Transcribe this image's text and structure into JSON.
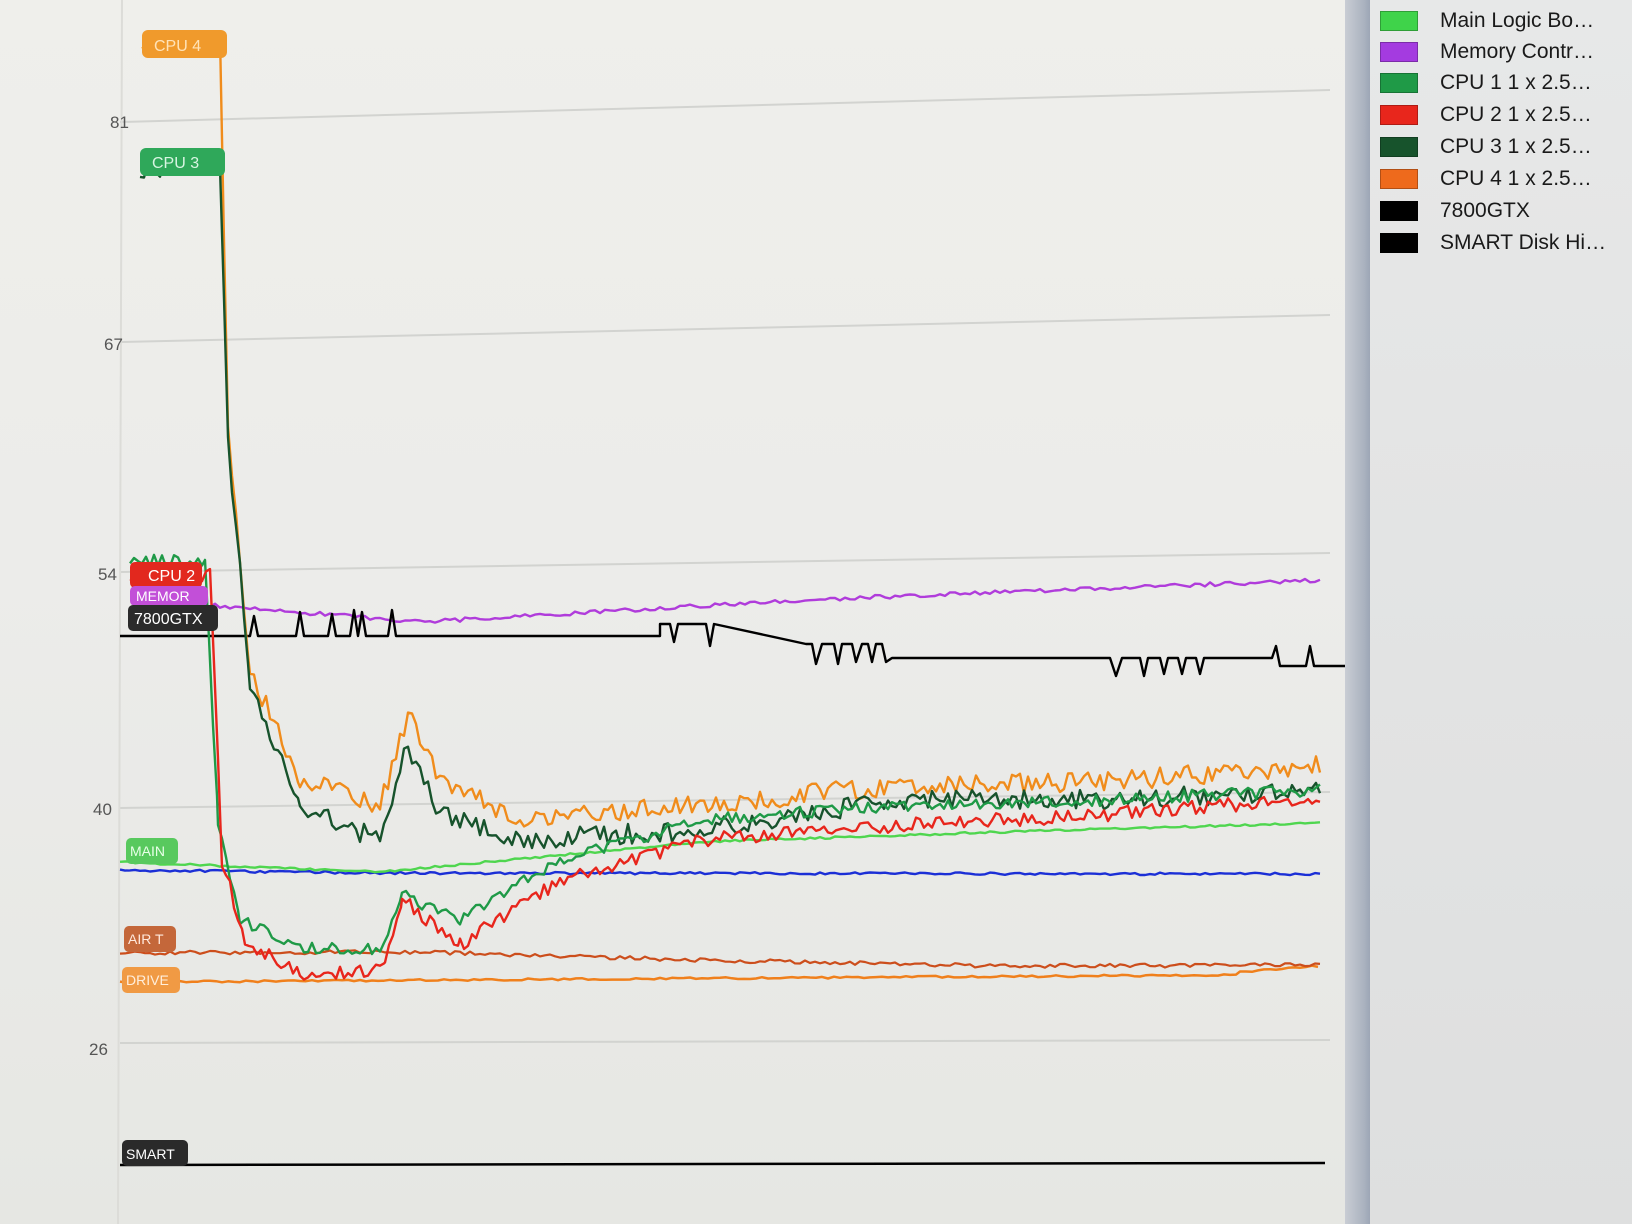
{
  "y_axis": {
    "ticks": [
      "81",
      "67",
      "54",
      "40",
      "26"
    ]
  },
  "tags": {
    "cpu4": "CPU 4",
    "cpu3": "CPU 3",
    "cpu2": "CPU 2",
    "memory": "MEMOR",
    "gpu": "7800GTX",
    "main": "MAIN",
    "air": "AIR T",
    "drive": "DRIVE",
    "smart": "SMART"
  },
  "legend": [
    {
      "label": "Main Logic Bo…",
      "color": "#3fd34a"
    },
    {
      "label": "Memory Contr…",
      "color": "#a43be0"
    },
    {
      "label": "CPU 1  1 x 2.5…",
      "color": "#1f9a47"
    },
    {
      "label": "CPU 2  1 x 2.5…",
      "color": "#e8261c"
    },
    {
      "label": "CPU 3  1 x 2.5…",
      "color": "#17532c"
    },
    {
      "label": "CPU 4  1 x 2.5…",
      "color": "#ee6a1c"
    },
    {
      "label": "7800GTX",
      "color": "#000000"
    },
    {
      "label": "SMART Disk Hi…",
      "color": "#000000"
    }
  ],
  "colors": {
    "main_logic": "#4fd64f",
    "memory": "#b03cdb",
    "cpu1": "#1f9a47",
    "cpu2": "#e8261c",
    "cpu3": "#17532c",
    "cpu4": "#f08c1c",
    "gpu": "#000000",
    "smart": "#000000",
    "blue_line": "#1b2fd6",
    "air": "#cc4e1c",
    "drive": "#f0801c"
  }
}
